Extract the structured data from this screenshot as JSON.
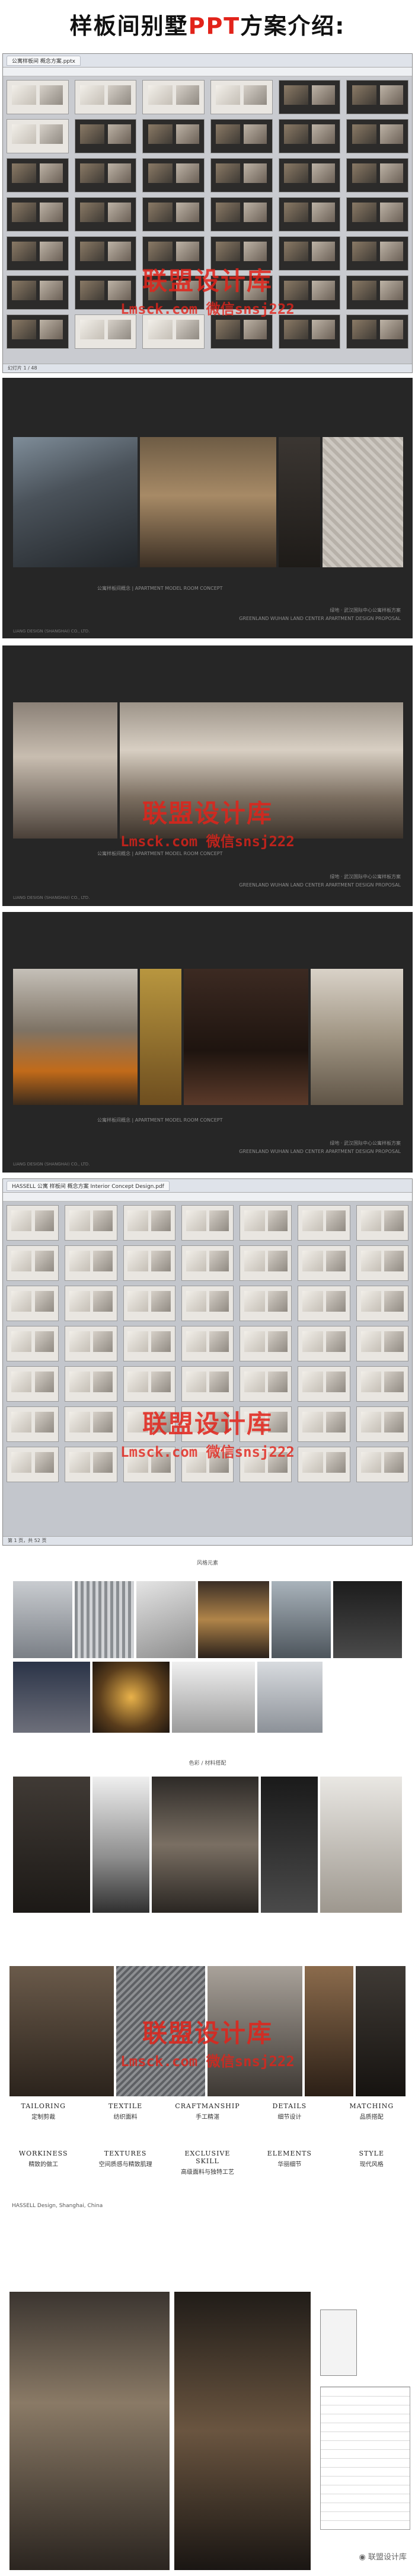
{
  "title": {
    "prefix": "样板间别墅",
    "accent": "PPT",
    "suffix": "方案介绍:"
  },
  "watermark": {
    "main": "联盟设计库",
    "sub": "Lmsck.com  微信snsj222"
  },
  "ppt1": {
    "tab_label": "公寓样板间 概念方案.pptx",
    "status": "幻灯片 1 / 48"
  },
  "ppt2": {
    "tab_label": "HASSELL 公寓 样板间 概念方案 Interior Concept Design.pdf",
    "status": "第 1 页，共 52 页"
  },
  "slide_footer": {
    "left": "公寓样板间概念  |  APARTMENT MODEL ROOM CONCEPT",
    "right_cn": "绿地 · 武汉国际中心公寓样板方案",
    "right_en": "GREENLAND WUHAN LAND CENTER APARTMENT DESIGN PROPOSAL",
    "company": "LIANG DESIGN (SHANGHAI) CO., LTD."
  },
  "board1": {
    "caption": "风格元素"
  },
  "board2": {
    "caption": "色彩 / 材料搭配"
  },
  "materials": [
    {
      "en": "TAILORING",
      "cn": "定制剪裁"
    },
    {
      "en": "TEXTILE",
      "cn": "纺织面料"
    },
    {
      "en": "CRAFTMANSHIP",
      "cn": "手工精湛"
    },
    {
      "en": "DETAILS",
      "cn": "细节设计"
    },
    {
      "en": "MATCHING",
      "cn": "品质搭配"
    }
  ],
  "materials2": [
    {
      "en": "WORKINESS",
      "cn": "精致的做工"
    },
    {
      "en": "TEXTURES",
      "cn": "空间质感与精致肌理"
    },
    {
      "en": "EXCLUSIVE SKILL",
      "cn": "高级面料与独特工艺"
    },
    {
      "en": "ELEMENTS",
      "cn": "华丽细节"
    },
    {
      "en": "STYLE",
      "cn": "现代风格"
    }
  ],
  "board_footer": "HASSELL Design, Shanghai, China",
  "credit": "联盟设计库"
}
